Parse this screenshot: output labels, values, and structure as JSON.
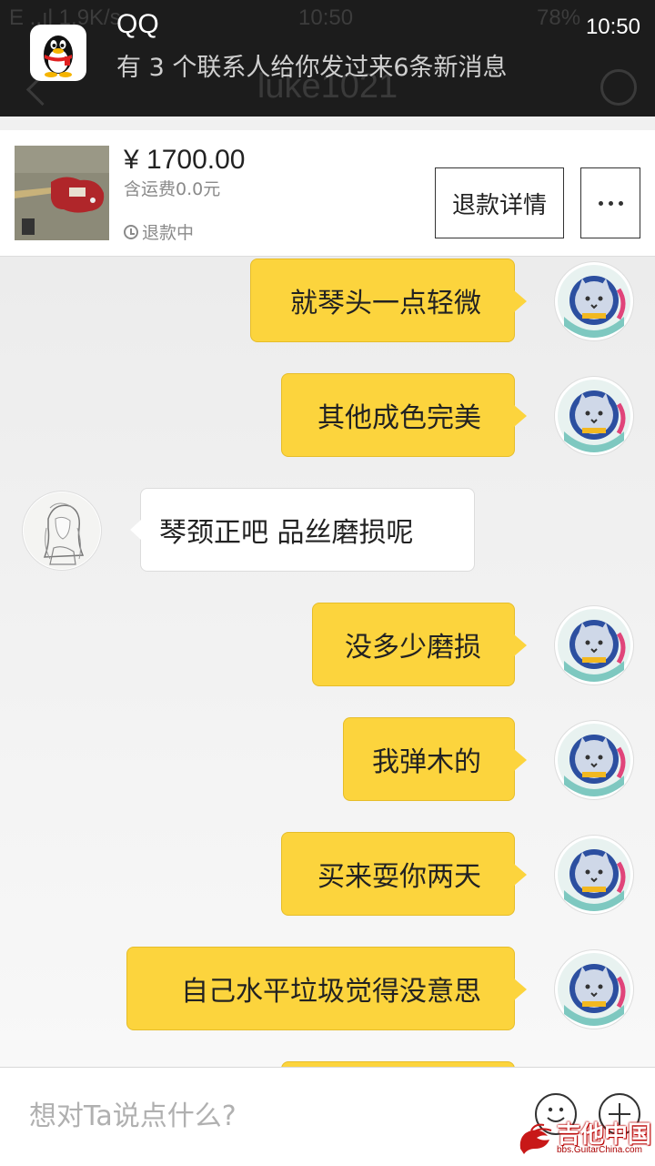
{
  "status_bar": {
    "left_ghost": "E ..ıl 1.9K/s",
    "center_time": "10:50",
    "right_ghost": "78%"
  },
  "notification": {
    "app_name": "QQ",
    "time": "10:50",
    "message": "有 3 个联系人给你发过来6条新消息"
  },
  "header": {
    "title": "luke1021"
  },
  "order": {
    "price": "¥ 1700.00",
    "shipping": "含运费0.0元",
    "status": "退款中",
    "refund_button": "退款详情"
  },
  "messages": [
    {
      "from": "self",
      "text": "就琴头一点轻微"
    },
    {
      "from": "self",
      "text": "其他成色完美"
    },
    {
      "from": "other",
      "text": "琴颈正吧 品丝磨损呢"
    },
    {
      "from": "self",
      "text": "没多少磨损"
    },
    {
      "from": "self",
      "text": "我弹木的"
    },
    {
      "from": "self",
      "text": "买来耍你两天"
    },
    {
      "from": "self",
      "text": "自己水平垃圾觉得没意思"
    }
  ],
  "input": {
    "placeholder": "想对Ta说点什么?"
  },
  "watermark": {
    "text": "吉他中国",
    "sub": "bbs.GuitarChina.com"
  },
  "colors": {
    "self_bubble": "#fcd43d",
    "other_bubble": "#ffffff",
    "status_bar": "#1c1c1c"
  }
}
